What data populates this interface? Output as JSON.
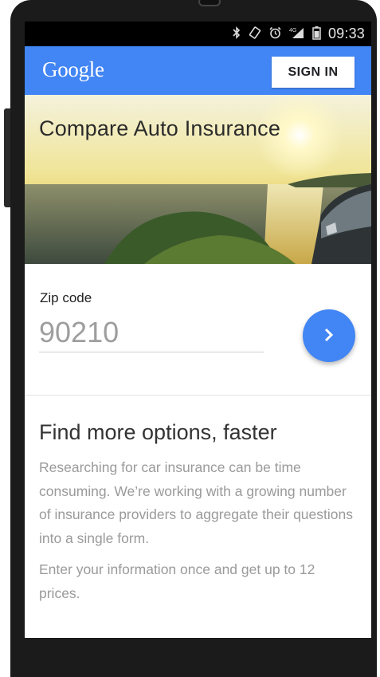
{
  "status_bar": {
    "icons": [
      "bluetooth-icon",
      "rotate-icon",
      "alarm-icon",
      "4g-signal-icon",
      "battery-icon"
    ],
    "network_label": "4G",
    "time": "09:33"
  },
  "app_bar": {
    "logo_text": "Google",
    "sign_in_label": "SIGN IN",
    "color": "#4285f4"
  },
  "hero": {
    "title": "Compare Auto Insurance"
  },
  "zip_form": {
    "label": "Zip code",
    "value": "90210",
    "submit_icon": "chevron-right-icon"
  },
  "info": {
    "title": "Find more options, faster",
    "paragraph_1": "Researching for car insurance can be time consuming. We’re working with a growing number of insurance providers to aggregate their questions into a single form.",
    "paragraph_2": "Enter your information once and get up to 12 prices."
  },
  "colors": {
    "accent": "#4285f4",
    "status_bar": "#000000",
    "body_text": "#9a9a9a"
  }
}
